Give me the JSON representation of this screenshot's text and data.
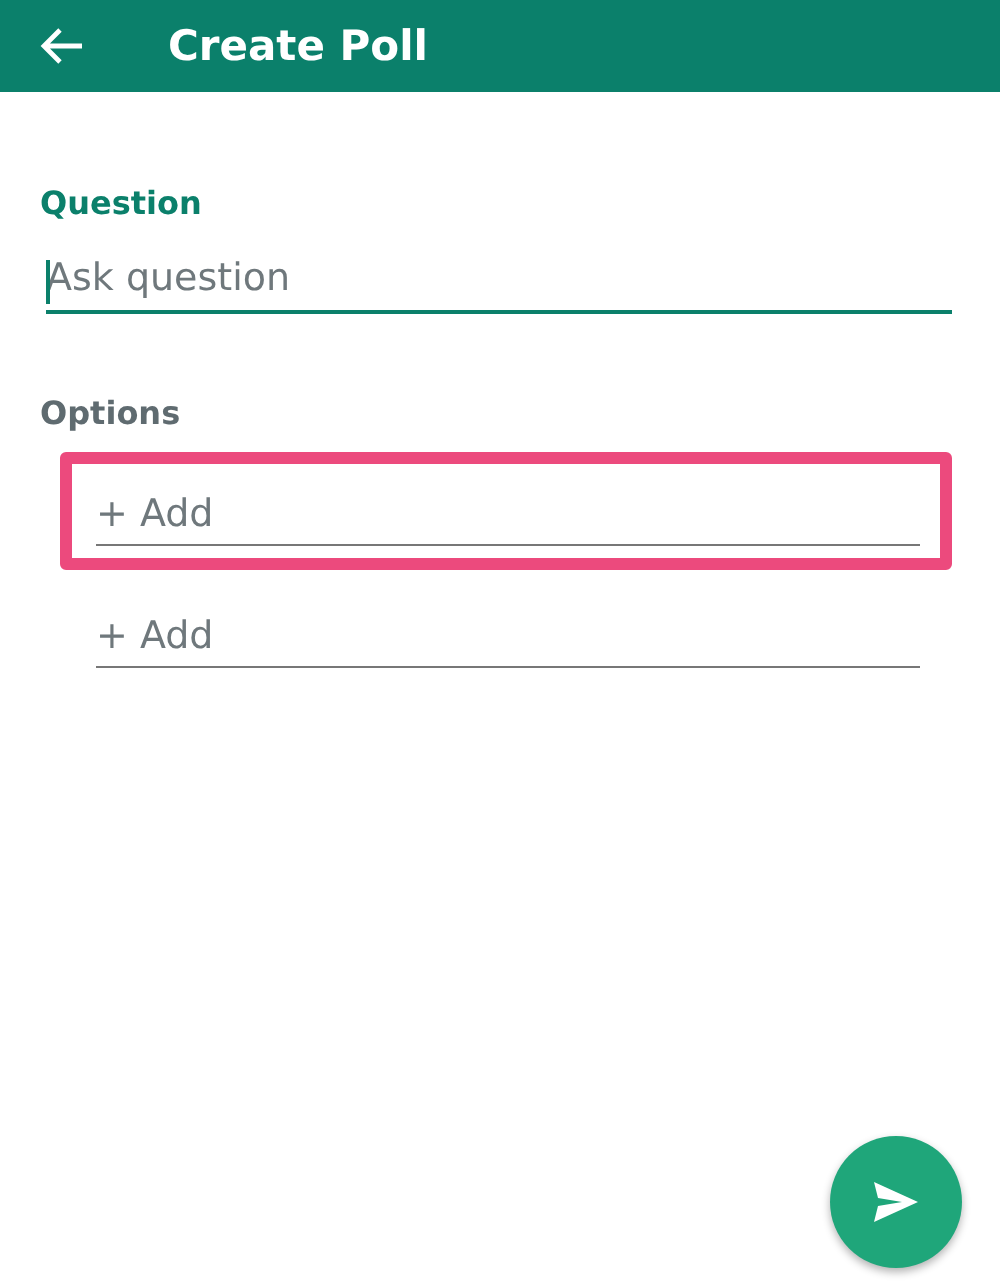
{
  "header": {
    "title": "Create Poll"
  },
  "question": {
    "label": "Question",
    "placeholder": "Ask question",
    "focused": true
  },
  "options": {
    "label": "Options",
    "items": [
      {
        "placeholder": "+ Add",
        "highlighted": true
      },
      {
        "placeholder": "+ Add",
        "highlighted": false
      }
    ]
  }
}
